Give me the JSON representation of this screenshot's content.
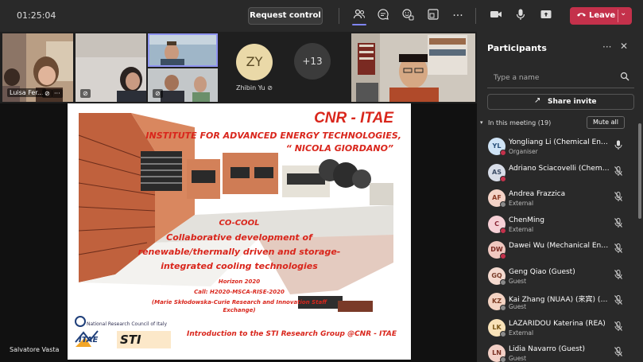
{
  "topbar": {
    "timer": "01:25:04",
    "request_control": "Request control",
    "leave_label": "Leave",
    "leave_color": "#c4314b",
    "icons": [
      "people-icon",
      "chat-icon",
      "reactions-icon",
      "rooms-icon",
      "more-icon",
      "camera-icon",
      "mic-icon",
      "share-icon"
    ]
  },
  "video_row": {
    "tile1_name": "Luisa Fer...",
    "tile1_more": "···",
    "avatar_initials": "ZY",
    "avatar_name": "Zhibin Yu",
    "more_count": "+13"
  },
  "stage": {
    "presenter": "Salvatore Vasta"
  },
  "slide": {
    "title": "CNR - ITAE",
    "subtitle1": "INSTITUTE FOR ADVANCED ENERGY TECHNOLOGIES,",
    "subtitle2": "“ NICOLA GIORDANO”",
    "project_name": "CO-COOL",
    "project_line1": "Collaborative development of",
    "project_line2": "renewable/thermally driven and storage-",
    "project_line3": "integrated cooling technologies",
    "horizon": "Horizon 2020",
    "call": "Call: H2020-MSCA-RISE-2020",
    "marie1": "(Marie Skłodowska-Curie Research and Innovation Staff",
    "marie2": "Exchange)",
    "nrc": "National Research Council of Italy",
    "logo_itae": "ITAE",
    "logo_sti": "STI",
    "bottom": "Introduction to the STI Research Group @CNR - ITAE",
    "accent": "#d9261c"
  },
  "panel": {
    "title": "Participants",
    "search_placeholder": "Type a name",
    "share_invite": "Share invite",
    "in_meeting": "In this meeting (19)",
    "mute_all": "Mute all",
    "participants": [
      {
        "initials": "YL",
        "name": "Yongliang Li (Chemical Engin...",
        "role": "Organiser",
        "bg": "#cfe3f5",
        "fg": "#29507a",
        "dot": "#c4314b",
        "mic": "mic-on"
      },
      {
        "initials": "AS",
        "name": "Adriano Sciacovelli (Chemical ...",
        "role": "",
        "bg": "#d8dde8",
        "fg": "#3d4d66",
        "dot": "#c4314b",
        "mic": "mic-off"
      },
      {
        "initials": "AF",
        "name": "Andrea Frazzica",
        "role": "External",
        "bg": "#f4d3c7",
        "fg": "#8a3a25",
        "dot": "#8a8a8a",
        "mic": "mic-off"
      },
      {
        "initials": "C",
        "name": "ChenMing",
        "role": "External",
        "bg": "#f6d0d6",
        "fg": "#8a2636",
        "dot": "#c4314b",
        "mic": "mic-off"
      },
      {
        "initials": "DW",
        "name": "Dawei Wu (Mechanical Engine...",
        "role": "",
        "bg": "#f0c8c0",
        "fg": "#7a2a22",
        "dot": "#c4314b",
        "mic": "mic-off"
      },
      {
        "initials": "GQ",
        "name": "Geng Qiao (Guest)",
        "role": "Guest",
        "bg": "#f4d9cf",
        "fg": "#7a3d2a",
        "dot": "#8a8a8a",
        "mic": "mic-off"
      },
      {
        "initials": "KZ",
        "name": "Kai Zhang (NUAA) (来宾) (Gu...",
        "role": "Guest",
        "bg": "#f3d3c3",
        "fg": "#7a3b22",
        "dot": "#8a8a8a",
        "mic": "mic-off"
      },
      {
        "initials": "LK",
        "name": "LAZARIDOU Katerina (REA)",
        "role": "External",
        "bg": "#f8e2b8",
        "fg": "#7a5818",
        "dot": "#8a8a8a",
        "mic": "mic-off"
      },
      {
        "initials": "LN",
        "name": "Lidia Navarro (Guest)",
        "role": "Guest",
        "bg": "#f3d0c6",
        "fg": "#7a3022",
        "dot": "#8a8a8a",
        "mic": "mic-off"
      }
    ]
  }
}
